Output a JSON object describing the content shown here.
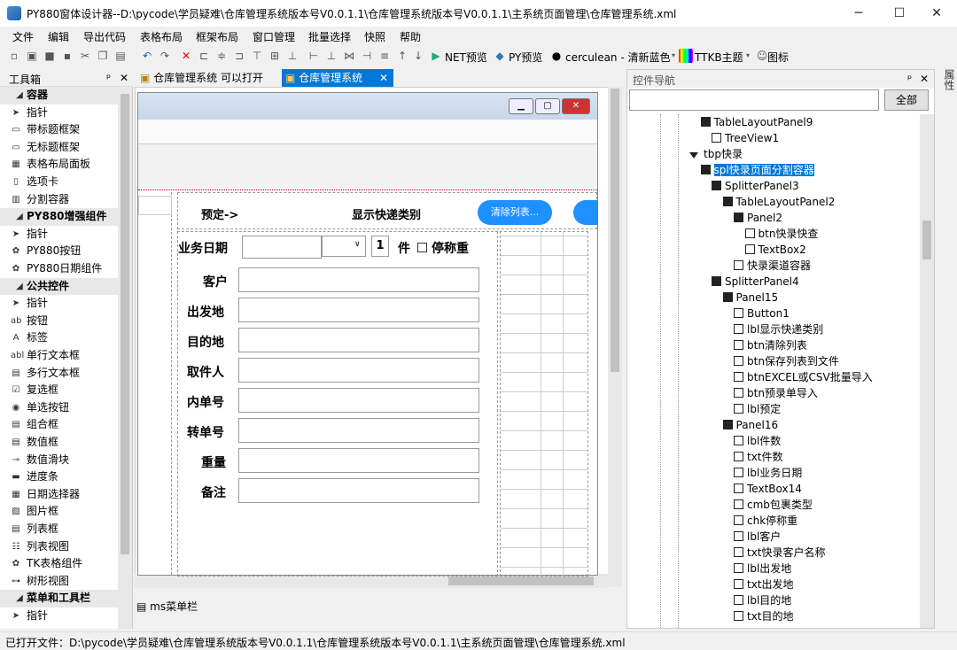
{
  "window": {
    "title": "PY880窗体设计器--D:\\pycode\\学员疑难\\仓库管理系统版本号V0.0.1.1\\仓库管理系统版本号V0.0.1.1\\主系统页面管理\\仓库管理系统.xml",
    "minimize": "─",
    "maximize": "☐",
    "close": "✕"
  },
  "menu": [
    "文件",
    "编辑",
    "导出代码",
    "表格布局",
    "框架布局",
    "窗口管理",
    "批量选择",
    "快照",
    "帮助"
  ],
  "toolbar": {
    "net_preview": "NET预览",
    "py_preview": "PY预览",
    "theme": "cerculean - 清新蓝色",
    "ttkb": "TTKB主题",
    "icons": "图标"
  },
  "toolbox": {
    "title": "工具箱",
    "pin": "ᵖ",
    "close": "✕",
    "items": [
      {
        "label": "容器",
        "group": true,
        "icon": "◢"
      },
      {
        "label": "指针",
        "icon": "➤"
      },
      {
        "label": "带标题框架",
        "icon": "▭"
      },
      {
        "label": "无标题框架",
        "icon": "▭"
      },
      {
        "label": "表格布局面板",
        "icon": "▦"
      },
      {
        "label": "选项卡",
        "icon": "▯"
      },
      {
        "label": "分割容器",
        "icon": "▥"
      },
      {
        "label": "PY880增强组件",
        "group": true,
        "icon": "◢"
      },
      {
        "label": "指针",
        "icon": "➤"
      },
      {
        "label": "PY880按钮",
        "icon": "✿"
      },
      {
        "label": "PY880日期组件",
        "icon": "✿"
      },
      {
        "label": "公共控件",
        "group": true,
        "icon": "◢"
      },
      {
        "label": "指针",
        "icon": "➤"
      },
      {
        "label": "按钮",
        "icon": "ab"
      },
      {
        "label": "标签",
        "icon": "A"
      },
      {
        "label": "单行文本框",
        "icon": "abl"
      },
      {
        "label": "多行文本框",
        "icon": "▤"
      },
      {
        "label": "复选框",
        "icon": "☑"
      },
      {
        "label": "单选按钮",
        "icon": "◉"
      },
      {
        "label": "组合框",
        "icon": "▤"
      },
      {
        "label": "数值框",
        "icon": "▤"
      },
      {
        "label": "数值滑块",
        "icon": "⊸"
      },
      {
        "label": "进度条",
        "icon": "▬"
      },
      {
        "label": "日期选择器",
        "icon": "▦"
      },
      {
        "label": "图片框",
        "icon": "▨"
      },
      {
        "label": "列表框",
        "icon": "▤"
      },
      {
        "label": "列表视图",
        "icon": "☷"
      },
      {
        "label": "TK表格组件",
        "icon": "✿"
      },
      {
        "label": "树形视图",
        "icon": "⊶"
      },
      {
        "label": "菜单和工具栏",
        "group": true,
        "icon": "◢"
      },
      {
        "label": "指针",
        "icon": "➤"
      }
    ]
  },
  "tabs": [
    {
      "label": "仓库管理系统 可以打开",
      "active": false
    },
    {
      "label": "仓库管理系统",
      "active": true,
      "close": "✕"
    }
  ],
  "form": {
    "preset": "预定->",
    "show_type": "显示快递类别",
    "clear_btn": "清除列表...",
    "date_label": "业务日期",
    "qty": "1",
    "qty_unit": "件",
    "stop_weigh": "停称重",
    "fields": [
      "客户",
      "出发地",
      "目的地",
      "取件人",
      "内单号",
      "转单号",
      "重量",
      "备注"
    ]
  },
  "menustrip_label": "ms菜单栏",
  "nav": {
    "title": "控件导航",
    "pin": "ᵖ",
    "close": "✕",
    "search_placeholder": "",
    "all_btn": "全部",
    "side_tab": "属性",
    "nodes": [
      {
        "label": "TableLayoutPanel9",
        "depth": 3,
        "type": "folder"
      },
      {
        "label": "TreeView1",
        "depth": 4,
        "type": "item"
      },
      {
        "label": "tbp快录",
        "depth": 2,
        "type": "diamond"
      },
      {
        "label": "spl快录页面分割容器",
        "depth": 3,
        "type": "folder",
        "selected": true
      },
      {
        "label": "SplitterPanel3",
        "depth": 4,
        "type": "folder"
      },
      {
        "label": "TableLayoutPanel2",
        "depth": 5,
        "type": "folder"
      },
      {
        "label": "Panel2",
        "depth": 6,
        "type": "folder"
      },
      {
        "label": "btn快录快查",
        "depth": 7,
        "type": "item"
      },
      {
        "label": "TextBox2",
        "depth": 7,
        "type": "item"
      },
      {
        "label": "快录渠道容器",
        "depth": 6,
        "type": "item"
      },
      {
        "label": "SplitterPanel4",
        "depth": 4,
        "type": "folder"
      },
      {
        "label": "Panel15",
        "depth": 5,
        "type": "folder"
      },
      {
        "label": "Button1",
        "depth": 6,
        "type": "item"
      },
      {
        "label": "lbl显示快递类别",
        "depth": 6,
        "type": "item"
      },
      {
        "label": "btn清除列表",
        "depth": 6,
        "type": "item"
      },
      {
        "label": "btn保存列表到文件",
        "depth": 6,
        "type": "item"
      },
      {
        "label": "btnEXCEL或CSV批量导入",
        "depth": 6,
        "type": "item"
      },
      {
        "label": "btn预录单导入",
        "depth": 6,
        "type": "item"
      },
      {
        "label": "lbl预定",
        "depth": 6,
        "type": "item"
      },
      {
        "label": "Panel16",
        "depth": 5,
        "type": "folder"
      },
      {
        "label": "lbl件数",
        "depth": 6,
        "type": "item"
      },
      {
        "label": "txt件数",
        "depth": 6,
        "type": "item"
      },
      {
        "label": "lbl业务日期",
        "depth": 6,
        "type": "item"
      },
      {
        "label": "TextBox14",
        "depth": 6,
        "type": "item"
      },
      {
        "label": "cmb包裹类型",
        "depth": 6,
        "type": "item"
      },
      {
        "label": "chk停称重",
        "depth": 6,
        "type": "item"
      },
      {
        "label": "lbl客户",
        "depth": 6,
        "type": "item"
      },
      {
        "label": "txt快录客户名称",
        "depth": 6,
        "type": "item"
      },
      {
        "label": "lbl出发地",
        "depth": 6,
        "type": "item"
      },
      {
        "label": "txt出发地",
        "depth": 6,
        "type": "item"
      },
      {
        "label": "lbl目的地",
        "depth": 6,
        "type": "item"
      },
      {
        "label": "txt目的地",
        "depth": 6,
        "type": "item"
      }
    ]
  },
  "status": "已打开文件：D:\\pycode\\学员疑难\\仓库管理系统版本号V0.0.1.1\\仓库管理系统版本号V0.0.1.1\\主系统页面管理\\仓库管理系统.xml"
}
